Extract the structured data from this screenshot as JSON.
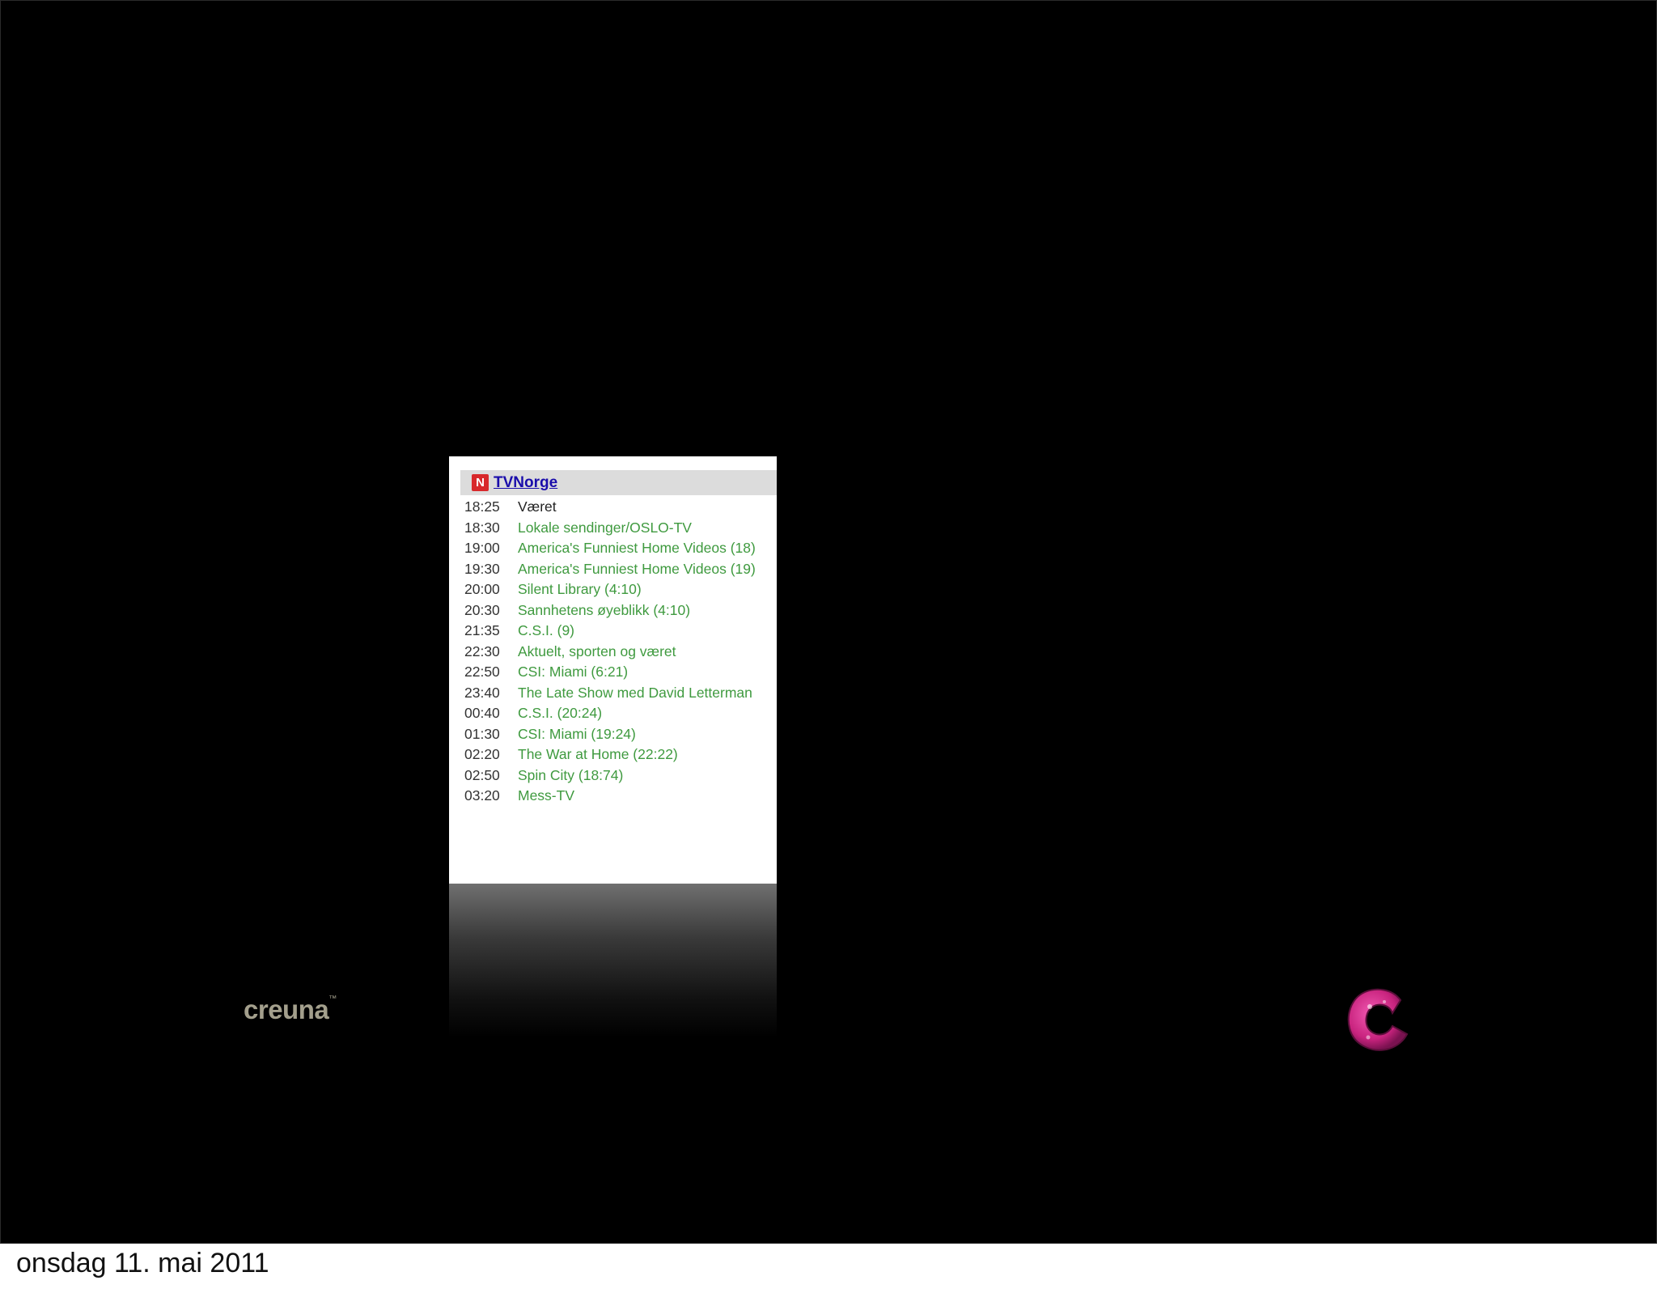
{
  "slide": {
    "channel": {
      "logo_letter": "N",
      "name": "TVNorge"
    },
    "schedule": [
      {
        "time": "18:25",
        "title": "Været"
      },
      {
        "time": "18:30",
        "title": "Lokale sendinger/OSLO-TV"
      },
      {
        "time": "19:00",
        "title": "America's Funniest Home Videos (18)"
      },
      {
        "time": "19:30",
        "title": "America's Funniest Home Videos (19)"
      },
      {
        "time": "20:00",
        "title": "Silent Library (4:10)"
      },
      {
        "time": "20:30",
        "title": "Sannhetens øyeblikk (4:10)"
      },
      {
        "time": "21:35",
        "title": "C.S.I. (9)"
      },
      {
        "time": "22:30",
        "title": "Aktuelt, sporten og været"
      },
      {
        "time": "22:50",
        "title": "CSI: Miami (6:21)"
      },
      {
        "time": "23:40",
        "title": "The Late Show med David Letterman"
      },
      {
        "time": "00:40",
        "title": "C.S.I. (20:24)"
      },
      {
        "time": "01:30",
        "title": "CSI: Miami (19:24)"
      },
      {
        "time": "02:20",
        "title": "The War at Home (22:22)"
      },
      {
        "time": "02:50",
        "title": "Spin City (18:74)"
      },
      {
        "time": "03:20",
        "title": "Mess-TV"
      }
    ],
    "brand_logo": "creuna",
    "colors": {
      "background": "#000000",
      "listing_title": "#3f9a3f",
      "channel_link": "#1a0dab",
      "channel_logo": "#d8282b",
      "c_logo": "#e0409a"
    }
  },
  "footer": {
    "date": "onsdag 11. mai 2011"
  }
}
